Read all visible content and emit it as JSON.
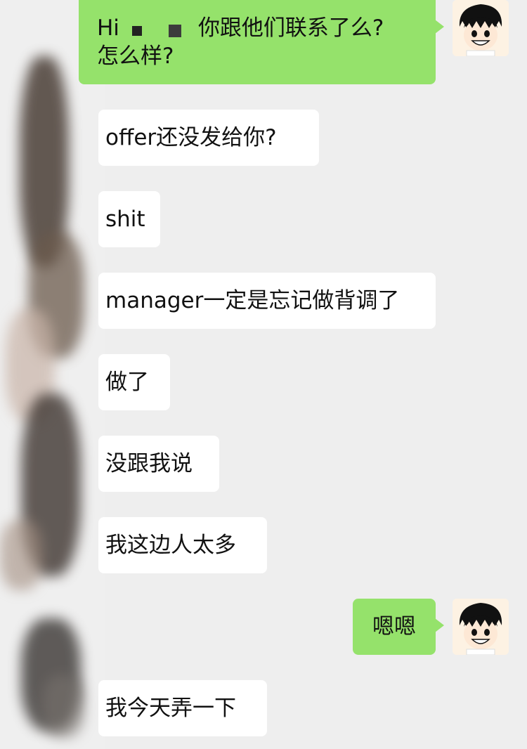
{
  "messages": [
    {
      "side": "out",
      "lines": [
        "Hi",
        "你跟他们联系了么?",
        "怎么样?"
      ]
    },
    {
      "side": "in",
      "text": "offer还没发给你?"
    },
    {
      "side": "in",
      "text": "shit"
    },
    {
      "side": "in",
      "text": "manager一定是忘记做背调了"
    },
    {
      "side": "in",
      "text": "做了"
    },
    {
      "side": "in",
      "text": "没跟我说"
    },
    {
      "side": "in",
      "text": "我这边人太多"
    },
    {
      "side": "out",
      "text": "嗯嗯"
    },
    {
      "side": "in",
      "text": "我今天弄一下"
    }
  ],
  "colors": {
    "background": "#eeeeee",
    "incoming_bubble": "#ffffff",
    "outgoing_bubble": "#95e26b"
  },
  "icons": {
    "self_avatar": "cartoon-boy-avatar-icon"
  }
}
